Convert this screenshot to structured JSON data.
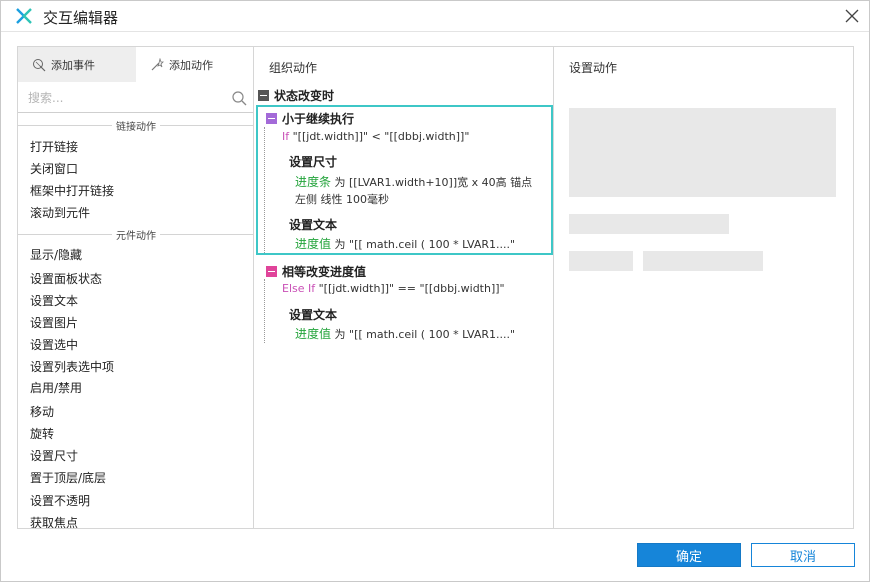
{
  "window": {
    "title": "交互编辑器"
  },
  "left": {
    "tabs": [
      {
        "label": "添加事件",
        "icon": "add-event-icon"
      },
      {
        "label": "添加动作",
        "icon": "add-action-icon"
      }
    ],
    "search": {
      "placeholder": "搜索..."
    },
    "sections": [
      {
        "title": "链接动作",
        "items": [
          "打开链接",
          "关闭窗口",
          "框架中打开链接",
          "滚动到元件"
        ]
      },
      {
        "title": "元件动作",
        "items": [
          "显示/隐藏",
          "设置面板状态",
          "设置文本",
          "设置图片",
          "设置选中",
          "设置列表选中项",
          "启用/禁用",
          "移动",
          "旋转",
          "设置尺寸",
          "置于顶层/底层",
          "设置不透明",
          "获取焦点"
        ]
      }
    ]
  },
  "middle": {
    "title": "组织动作",
    "event": "状态改变时",
    "cases": [
      {
        "name": "小于继续执行",
        "toggle_color": "#a36ad8",
        "keyword": "If",
        "condition": "\"[[jdt.width]]\" < \"[[dbbj.width]]\"",
        "actions": [
          {
            "title": "设置尺寸",
            "target": "进度条",
            "detail": " 为 [[LVAR1.width+10]]宽 x 40高  锚点",
            "detail2": "左侧 线性 100毫秒"
          },
          {
            "title": "设置文本",
            "target": "进度值",
            "detail": " 为 \"[[ math.ceil ( 100 * LVAR1....\""
          }
        ]
      },
      {
        "name": "相等改变进度值",
        "toggle_color": "#e0449a",
        "keyword": "Else If",
        "condition": "\"[[jdt.width]]\" == \"[[dbbj.width]]\"",
        "actions": [
          {
            "title": "设置文本",
            "target": "进度值",
            "detail": " 为 \"[[ math.ceil ( 100 * LVAR1....\""
          }
        ]
      }
    ]
  },
  "right": {
    "title": "设置动作"
  },
  "footer": {
    "ok_label": "确定",
    "cancel_label": "取消"
  },
  "colors": {
    "accent": "#1685d9",
    "selection_border": "#3ec7c7",
    "keyword": "#c94fb6",
    "target": "#22a33a"
  }
}
